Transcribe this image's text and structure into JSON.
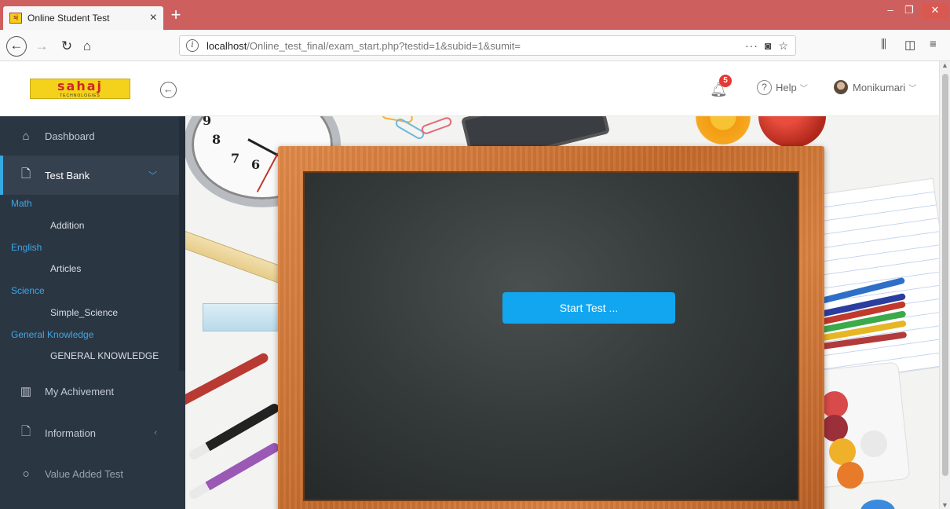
{
  "browser": {
    "tab_title": "Online Student Test",
    "tab_close": "×",
    "new_tab": "+",
    "url_host": "localhost",
    "url_path": "/Online_test_final/exam_start.php?testid=1&subid=1&sumit=",
    "page_actions": "···"
  },
  "header": {
    "logo_text": "sahaj",
    "logo_sub": "TECHNOLOGIES",
    "notification_count": "5",
    "help_label": "Help",
    "user_name": "Monikumari"
  },
  "sidebar": {
    "dashboard": "Dashboard",
    "test_bank": "Test Bank",
    "categories": [
      {
        "name": "Math",
        "item": "Addition"
      },
      {
        "name": "English",
        "item": "Articles"
      },
      {
        "name": "Science",
        "item": "Simple_Science"
      },
      {
        "name": "General Knowledge",
        "item": "GENERAL KNOWLEDGE"
      }
    ],
    "my_achievement": "My Achivement",
    "information": "Information",
    "value_added_test": "Value Added Test"
  },
  "main": {
    "start_button": "Start Test ..."
  },
  "colors": {
    "sidebar_bg": "#2b3643",
    "accent": "#36a9e1",
    "start_button": "#12a6f0",
    "tabbar": "#cd5f5f"
  },
  "icons": [
    "home-icon",
    "file-icon",
    "chart-icon",
    "info-file-icon",
    "bell-icon",
    "help-icon",
    "back-arrow-icon"
  ]
}
